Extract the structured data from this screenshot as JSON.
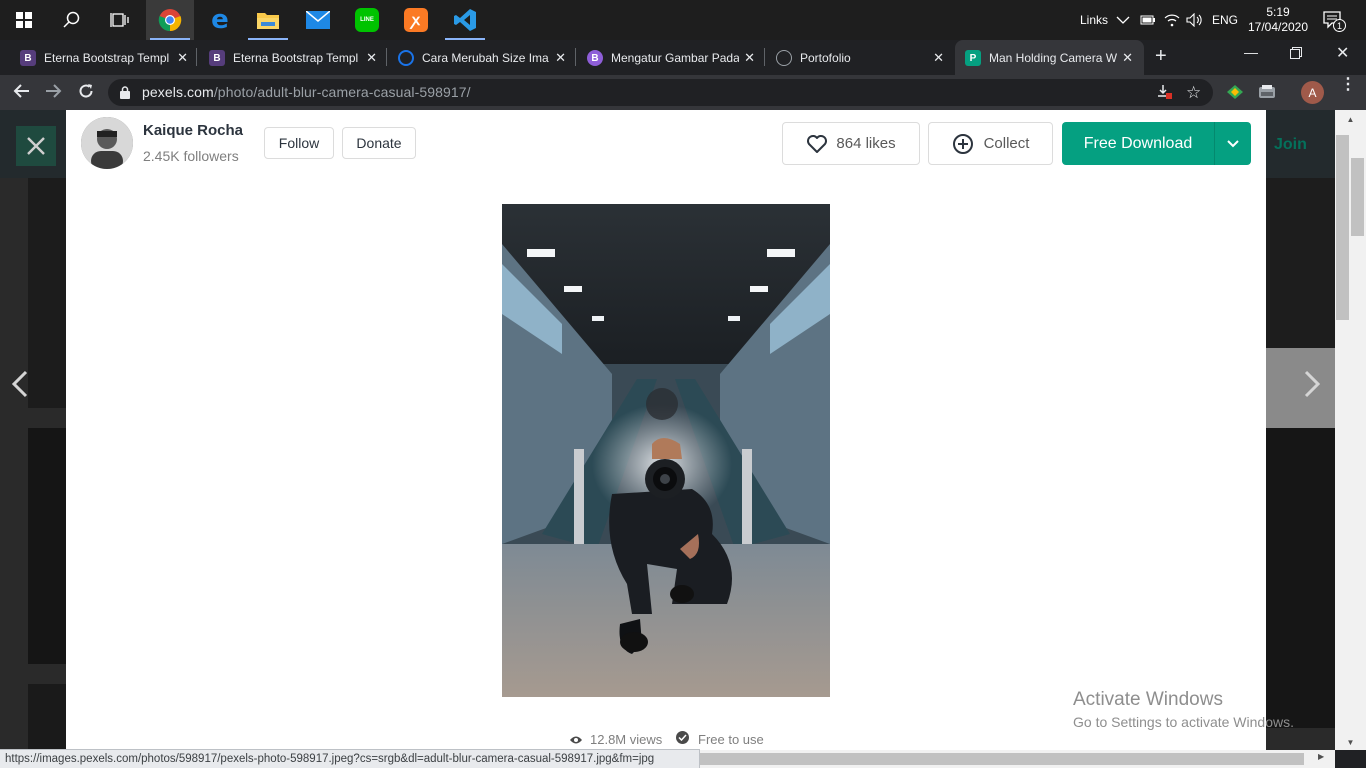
{
  "taskbar": {
    "apps": [
      "start-icon",
      "search-icon",
      "task-view-icon",
      "chrome-icon",
      "edge-icon",
      "file-explorer-icon",
      "mail-icon",
      "line-icon",
      "xampp-icon",
      "vscode-icon"
    ],
    "tray_links": "Links",
    "language": "ENG",
    "time": "5:19",
    "date": "17/04/2020",
    "notifications": "1"
  },
  "tabs": [
    {
      "title": "Eterna Bootstrap Templ",
      "favicon": "B",
      "color": "#563d7c"
    },
    {
      "title": "Eterna Bootstrap Templ",
      "favicon": "B",
      "color": "#563d7c"
    },
    {
      "title": "Cara Merubah Size Ima",
      "favicon": "",
      "color": "#1a73e8"
    },
    {
      "title": "Mengatur Gambar Pada",
      "favicon": "B",
      "color": "#8e5ed8"
    },
    {
      "title": "Portofolio",
      "favicon": "",
      "color": "#9aa0a6"
    },
    {
      "title": "Man Holding Camera W",
      "favicon": "P",
      "color": "#05a081"
    }
  ],
  "address": {
    "domain": "pexels.com",
    "path": "/photo/adult-blur-camera-casual-598917/"
  },
  "photographer": {
    "name": "Kaique Rocha",
    "followers": "2.45K followers",
    "follow_label": "Follow",
    "donate_label": "Donate"
  },
  "actions": {
    "likes_label": "864 likes",
    "collect_label": "Collect",
    "download_label": "Free Download"
  },
  "background": {
    "join_label": "Join"
  },
  "stats": {
    "views": "12.8M views",
    "license": "Free to use"
  },
  "status_url": "https://images.pexels.com/photos/598917/pexels-photo-598917.jpeg?cs=srgb&dl=adult-blur-camera-casual-598917.jpg&fm=jpg",
  "watermark": {
    "title": "Activate Windows",
    "subtitle": "Go to Settings to activate Windows."
  },
  "colors": {
    "brand": "#05a081",
    "taskbar": "#1e1e1e",
    "chrome_frame": "#202124",
    "chrome_toolbar": "#35363a"
  }
}
